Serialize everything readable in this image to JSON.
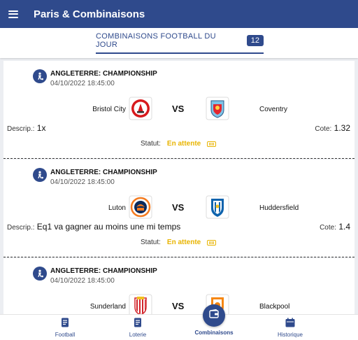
{
  "appbar": {
    "title": "Paris & Combinaisons"
  },
  "tab": {
    "label": "COMBINAISONS FOOTBALL DU JOUR",
    "count": "12"
  },
  "labels": {
    "descrip": "Descrip.:",
    "cote": "Cote:",
    "statut": "Statut:",
    "vs": "VS"
  },
  "matches": [
    {
      "league": "ANGLETERRE: CHAMPIONSHIP",
      "datetime": "04/10/2022 18:45:00",
      "home": "Bristol City",
      "away": "Coventry",
      "descrip": "1x",
      "cote": "1.32",
      "statut": "En attente"
    },
    {
      "league": "ANGLETERRE: CHAMPIONSHIP",
      "datetime": "04/10/2022 18:45:00",
      "home": "Luton",
      "away": "Huddersfield",
      "descrip": "Eq1 va gagner au moins une mi temps",
      "cote": "1.4",
      "statut": "En attente"
    },
    {
      "league": "ANGLETERRE: CHAMPIONSHIP",
      "datetime": "04/10/2022 18:45:00",
      "home": "Sunderland",
      "away": "Blackpool"
    }
  ],
  "nav": {
    "football": "Football",
    "loterie": "Loterie",
    "combinaisons": "Combinaisons",
    "historique": "Historique"
  },
  "colors": {
    "primary": "#2f4a8c",
    "status_pending": "#e8b400"
  },
  "icons": [
    "menu-icon",
    "football-player-icon",
    "wait-icon",
    "document-icon",
    "wallet-icon",
    "calendar-icon"
  ]
}
